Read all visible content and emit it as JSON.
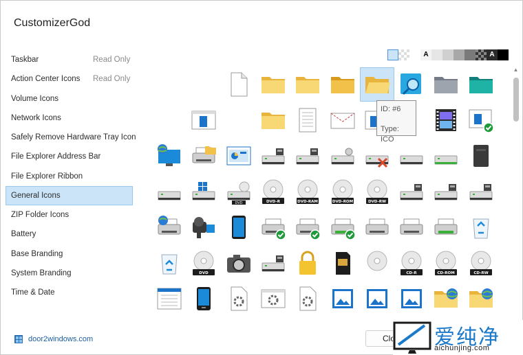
{
  "window": {
    "title": "CustomizerGod"
  },
  "sidebar": {
    "items": [
      {
        "label": "Taskbar",
        "badge": "Read Only"
      },
      {
        "label": "Action Center Icons",
        "badge": "Read Only"
      },
      {
        "label": "Volume Icons",
        "badge": ""
      },
      {
        "label": "Network Icons",
        "badge": ""
      },
      {
        "label": "Safely Remove Hardware Tray Icon",
        "badge": ""
      },
      {
        "label": "File Explorer Address Bar",
        "badge": ""
      },
      {
        "label": "File Explorer Ribbon",
        "badge": ""
      },
      {
        "label": "General Icons",
        "badge": "",
        "selected": true
      },
      {
        "label": "ZIP Folder Icons",
        "badge": ""
      },
      {
        "label": "Battery",
        "badge": ""
      },
      {
        "label": "Base Branding",
        "badge": ""
      },
      {
        "label": "System Branding",
        "badge": ""
      },
      {
        "label": "Time & Date",
        "badge": ""
      }
    ]
  },
  "background_swatches": [
    {
      "color": "#cce4f7",
      "label": ""
    },
    {
      "color": "checker-light",
      "label": ""
    },
    {
      "color": "#ffffff",
      "label": ""
    },
    {
      "color": "#f3f3f3",
      "label": "A"
    },
    {
      "color": "#e6e6e6",
      "label": ""
    },
    {
      "color": "#d0d0d0",
      "label": ""
    },
    {
      "color": "#a8a8a8",
      "label": ""
    },
    {
      "color": "#7a7a7a",
      "label": ""
    },
    {
      "color": "checker-dark",
      "label": ""
    },
    {
      "color": "#2b2b2b",
      "label": "A"
    },
    {
      "color": "#000000",
      "label": ""
    }
  ],
  "tooltip": {
    "id_text": "ID: #6",
    "type_text": "Type: ICO"
  },
  "icons": [
    [
      "blank",
      "blank",
      "document",
      "folder",
      "folder",
      "folder-dark",
      "folder-open-sel",
      "search-blue",
      "folder-gray",
      "folder-teal"
    ],
    [
      "blank",
      "window-app",
      "blank",
      "folder",
      "notepad",
      "envelope",
      "window-app2",
      "blank",
      "film",
      "window-check"
    ],
    [
      "globe-monitor",
      "printer-folder",
      "control-panel",
      "drive-net",
      "drive-net",
      "drive-net2",
      "drive-x",
      "drive",
      "drive-green",
      "drive-black"
    ],
    [
      "drive",
      "drive-win",
      "drive-dvd",
      "disc-dvd-r",
      "disc-dvd-ram",
      "disc-dvd-rom",
      "disc-dvd-rw",
      "drive-net",
      "drive-net",
      "drive-net"
    ],
    [
      "printer-globe",
      "camcorder",
      "phone-blue",
      "printer-check",
      "printer-check",
      "printer-check-green",
      "printer",
      "printer",
      "printer-green",
      "recycle-full"
    ],
    [
      "recycle-empty",
      "disc-dvd",
      "camera",
      "drive-net",
      "padlock",
      "sd-card",
      "disc",
      "disc-cd-r",
      "disc-cd-rom",
      "disc-cd-rw"
    ],
    [
      "window-doc",
      "phone-dark",
      "gear-doc",
      "gear-window",
      "gear-doc",
      "image-blue",
      "image-blue",
      "image-blue",
      "folder-globe",
      "folder-globe"
    ]
  ],
  "disc_labels": {
    "disc-dvd-r": "DVD-R",
    "disc-dvd-ram": "DVD-RAM",
    "disc-dvd-rom": "DVD-ROM",
    "disc-dvd-rw": "DVD-RW",
    "drive-dvd": "DVD",
    "disc-dvd": "DVD",
    "disc-cd-r": "CD-R",
    "disc-cd-rom": "CD-ROM",
    "disc-cd-rw": "CD-RW"
  },
  "footer": {
    "brand": "door2windows.com",
    "close_label": "Close"
  },
  "watermark": {
    "cn": "爱纯净",
    "url": "aichunjing.com"
  }
}
